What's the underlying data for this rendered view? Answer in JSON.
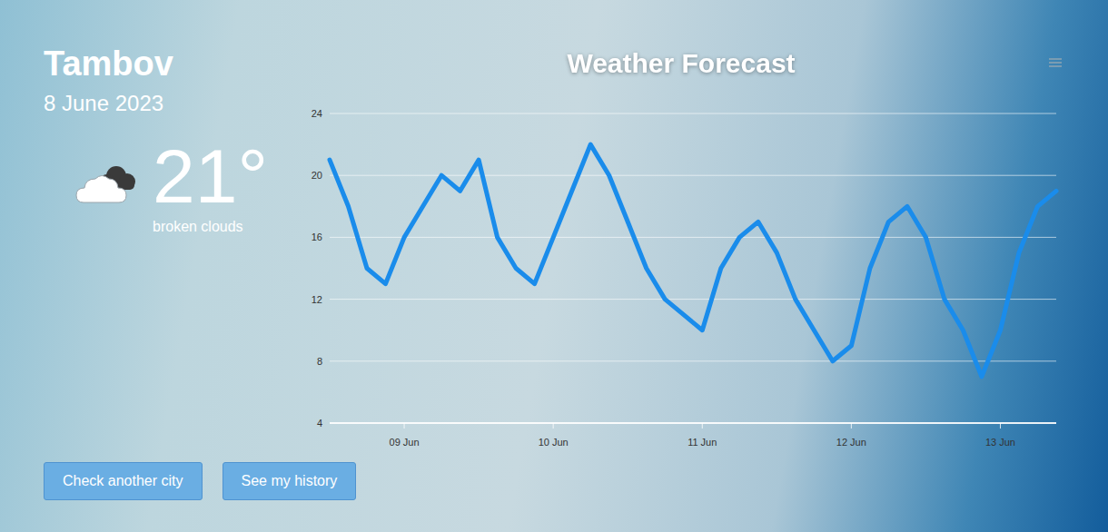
{
  "city": "Tambov",
  "date": "8 June 2023",
  "current": {
    "temperature": "21°",
    "condition": "broken clouds"
  },
  "chart": {
    "title": "Weather Forecast",
    "y_ticks": [
      "24",
      "20",
      "16",
      "12",
      "8",
      "4"
    ],
    "y_min": 4,
    "y_max": 24,
    "x_ticks": [
      {
        "label": "09 Jun",
        "index": 4
      },
      {
        "label": "10 Jun",
        "index": 12
      },
      {
        "label": "11 Jun",
        "index": 20
      },
      {
        "label": "12 Jun",
        "index": 28
      },
      {
        "label": "13 Jun",
        "index": 36
      }
    ],
    "series": [
      {
        "name": "temperature",
        "values": [
          21,
          18,
          14,
          13,
          16,
          18,
          20,
          19,
          21,
          16,
          14,
          13,
          16,
          19,
          22,
          20,
          17,
          14,
          12,
          11,
          10,
          14,
          16,
          17,
          15,
          12,
          10,
          8,
          9,
          14,
          17,
          18,
          16,
          12,
          10,
          7,
          10,
          15,
          18,
          19
        ]
      }
    ]
  },
  "buttons": [
    {
      "label": "Check another city"
    },
    {
      "label": "See my history"
    }
  ]
}
